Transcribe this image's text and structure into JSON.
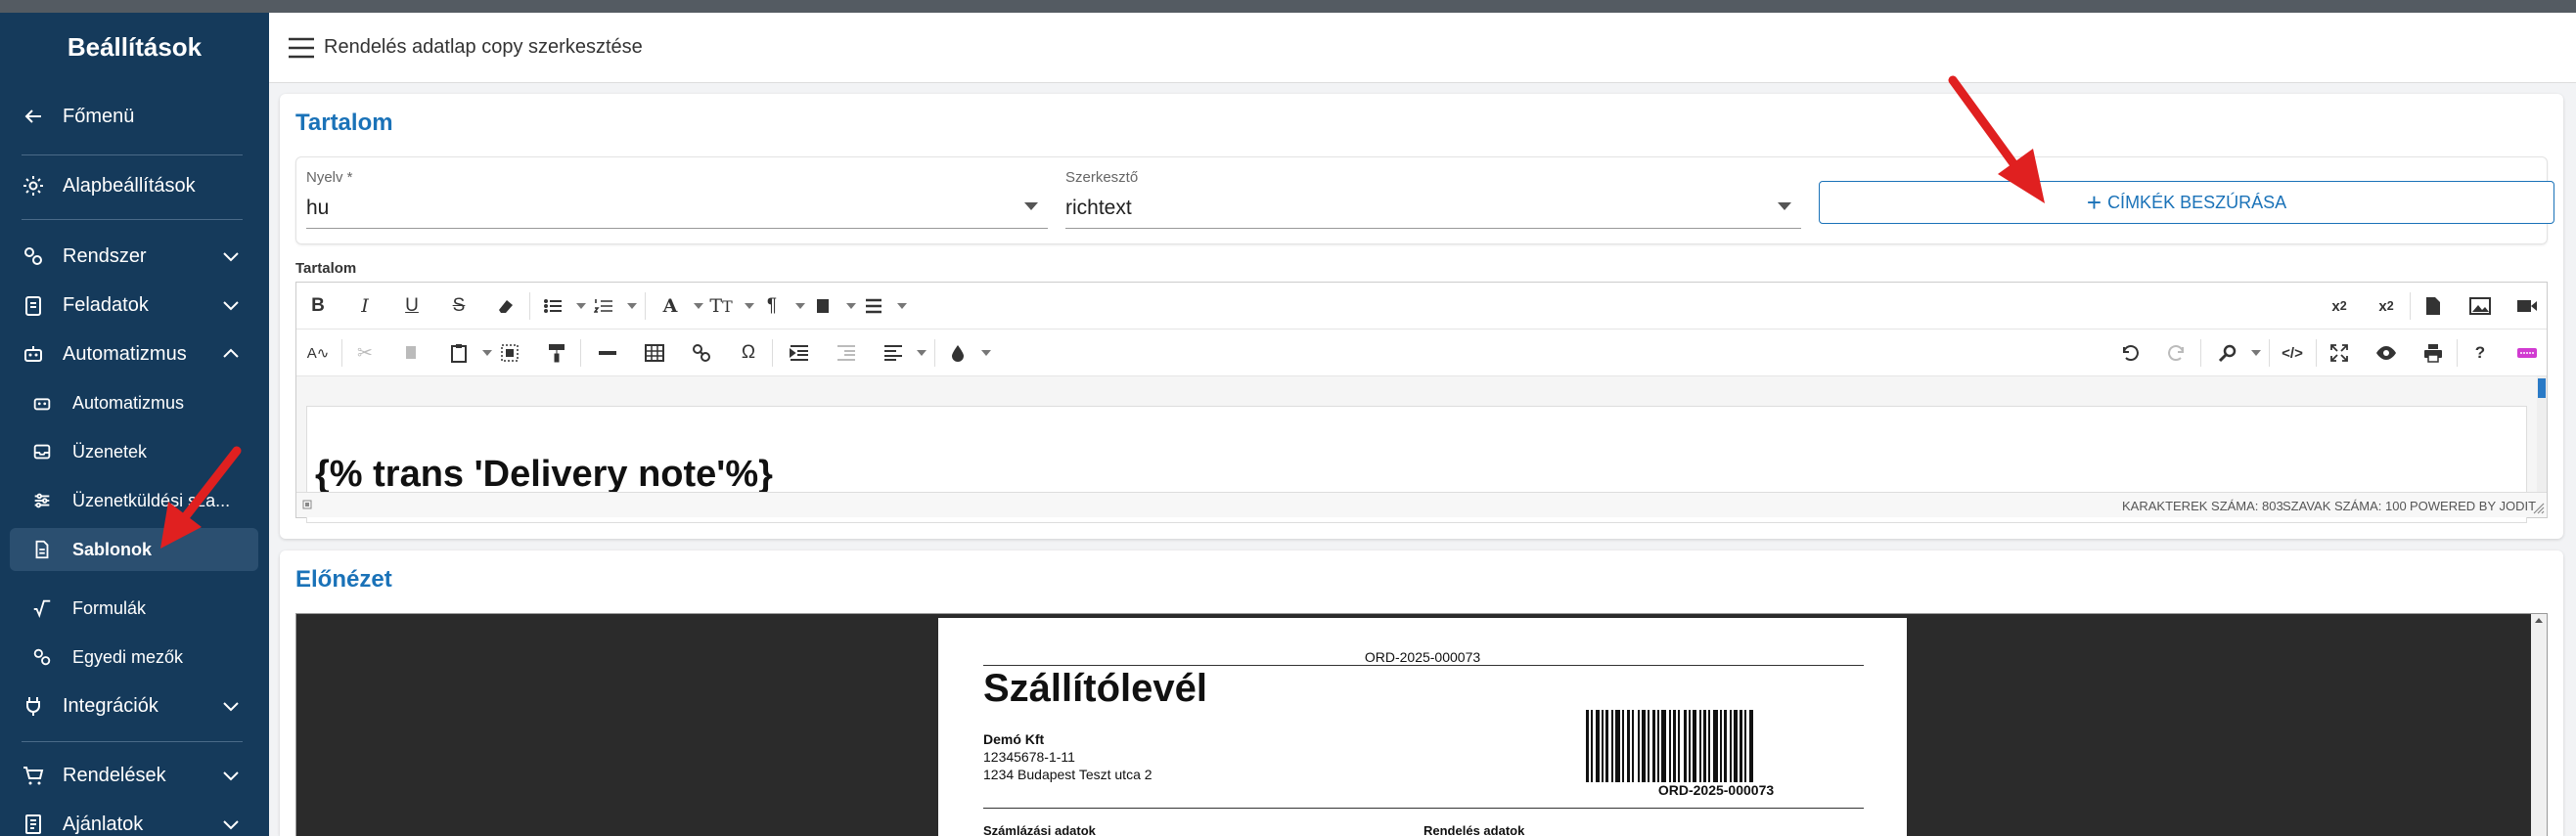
{
  "sidebar": {
    "title": "Beállítások",
    "items": [
      {
        "label": "Főmenü",
        "icon": "arrow-left-icon"
      },
      {
        "label": "Alapbeállítások",
        "icon": "gear-icon"
      },
      {
        "label": "Rendszer",
        "icon": "cogs-icon"
      },
      {
        "label": "Feladatok",
        "icon": "clipboard-icon"
      },
      {
        "label": "Automatizmus",
        "icon": "robot-icon"
      },
      {
        "label": "Automatizmus",
        "icon": "robot-icon"
      },
      {
        "label": "Üzenetek",
        "icon": "inbox-icon"
      },
      {
        "label": "Üzenetküldési sza...",
        "icon": "sliders-icon"
      },
      {
        "label": "Sablonok",
        "icon": "document-icon"
      },
      {
        "label": "Formulák",
        "icon": "sqrt-icon"
      },
      {
        "label": "Egyedi mezők",
        "icon": "fields-icon"
      },
      {
        "label": "Integrációk",
        "icon": "plug-icon"
      },
      {
        "label": "Rendelések",
        "icon": "cart-icon"
      },
      {
        "label": "Ajánlatok",
        "icon": "invoice-icon"
      }
    ]
  },
  "header": {
    "title": "Rendelés adatlap copy szerkesztése"
  },
  "content_card": {
    "title": "Tartalom",
    "language": {
      "label": "Nyelv *",
      "value": "hu"
    },
    "editor_type": {
      "label": "Szerkesztő",
      "value": "richtext"
    },
    "insert_tags_label": "CÍMKÉK BESZÚRÁSA",
    "editor_label": "Tartalom",
    "editor_heading": "{% trans 'Delivery note'%}",
    "status": {
      "chars": "KARAKTEREK SZÁMA: 803",
      "words": "SZAVAK SZÁMA: 100",
      "powered": "POWERED BY JODIT"
    }
  },
  "preview_card": {
    "title": "Előnézet",
    "document": {
      "order_number": "ORD-2025-000073",
      "title": "Szállítólevél",
      "company": "Demó Kft",
      "tax_id": "12345678-1-11",
      "address": "1234 Budapest Teszt utca 2",
      "barcode_text": "ORD-2025-000073",
      "billing_heading": "Számlázási adatok",
      "order_heading": "Rendelés adatok"
    }
  },
  "colors": {
    "sidebar": "#153a5b",
    "accent": "#1a72b8",
    "arrow": "#e02020"
  }
}
